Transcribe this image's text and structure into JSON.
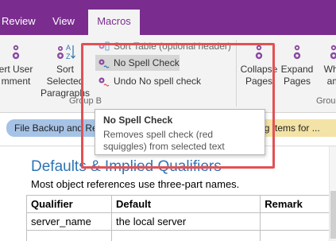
{
  "tabs": {
    "review": "Review",
    "view": "View",
    "macros": "Macros"
  },
  "ribbon": {
    "insert_user_label": "ert User\nmment",
    "sort_selected_label": "Sort Selected\nParagraphs",
    "sort_table_label": "Sort Table (optional header)",
    "no_spell_check_label": "No Spell Check",
    "undo_no_spell_label": "Undo No spell check",
    "group_b_label": "Group B",
    "collapse_label": "Collapse\nPages",
    "expand_label": "Expand\nPages",
    "whe_label": "Whe\nam",
    "gro_label": "Grou"
  },
  "page_tabs": {
    "left_tab": "File Backup and Re",
    "right_tab": "nding Items for ..."
  },
  "tooltip": {
    "title": "No Spell Check",
    "body": "Removes spell check (red squiggles) from selected text"
  },
  "content": {
    "title": "Defaults & Implied Qualifiers",
    "subtitle": "Most object references use three-part names.",
    "table": {
      "headers": [
        "Qualifier",
        "Default",
        "Remark"
      ],
      "rows": [
        [
          "server_name",
          "the local server",
          ""
        ]
      ]
    }
  },
  "colors": {
    "accent_purple": "#7a2d8e",
    "highlight_red": "#e25154",
    "title_blue": "#2e74b5"
  }
}
